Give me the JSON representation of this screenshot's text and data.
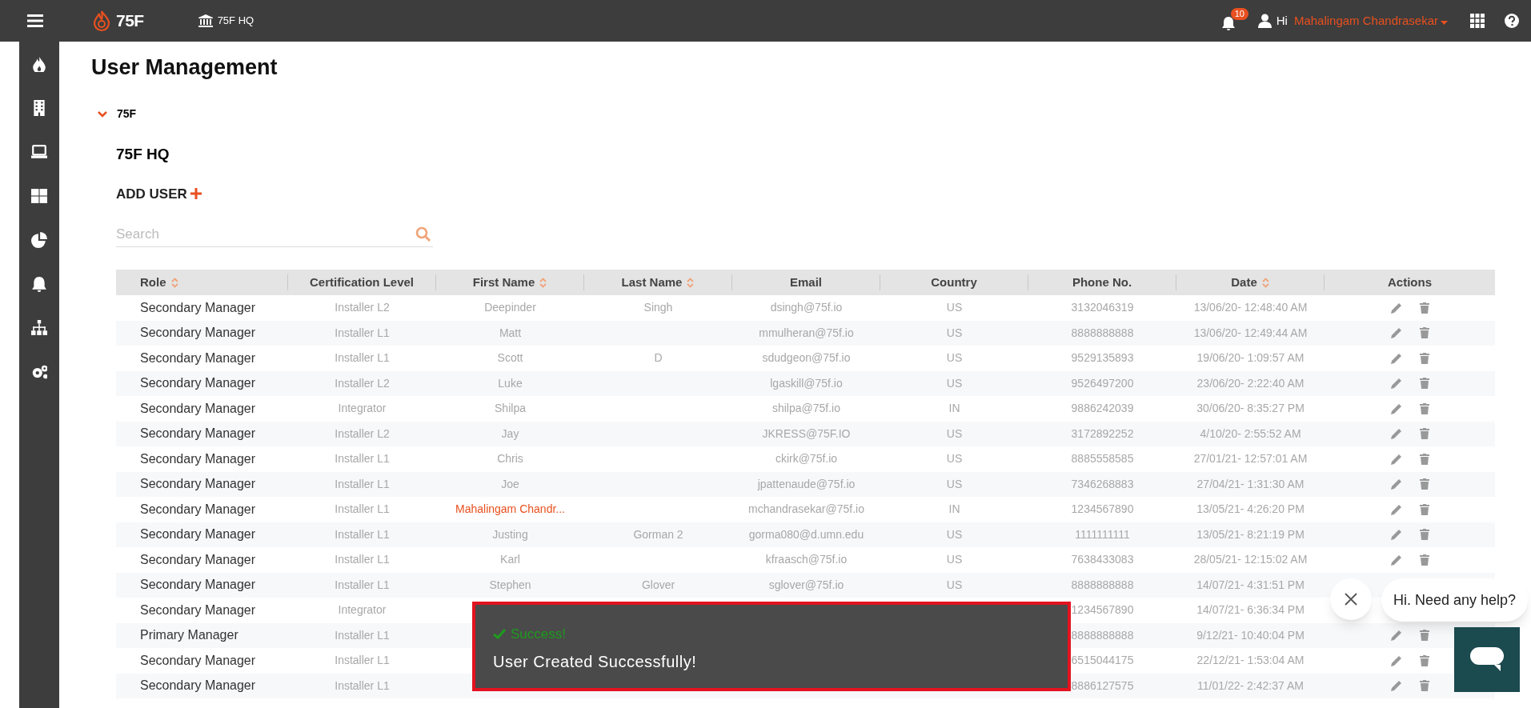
{
  "topbar": {
    "logo": "75F",
    "site": "75F HQ",
    "notifications": "10",
    "greeting": "Hi",
    "user": "Mahalingam Chandrasekar"
  },
  "page_title": "User Management",
  "tree": {
    "label": "75F",
    "expanded": true,
    "site": "75F HQ"
  },
  "add_user": "ADD USER",
  "search": {
    "placeholder": "Search"
  },
  "table": {
    "columns": [
      {
        "label": "Role",
        "sortable": true
      },
      {
        "label": "Certification Level",
        "sortable": false
      },
      {
        "label": "First Name",
        "sortable": true
      },
      {
        "label": "Last Name",
        "sortable": true
      },
      {
        "label": "Email",
        "sortable": false
      },
      {
        "label": "Country",
        "sortable": false
      },
      {
        "label": "Phone No.",
        "sortable": false
      },
      {
        "label": "Date",
        "sortable": true
      },
      {
        "label": "Actions",
        "sortable": false
      }
    ],
    "rows": [
      {
        "role": "Secondary Manager",
        "certification": "Installer L2",
        "first_name": "Deepinder",
        "last_name": "Singh",
        "email": "dsingh@75f.io",
        "country": "US",
        "phone": "3132046319",
        "date": "13/06/20- 12:48:40 AM"
      },
      {
        "role": "Secondary Manager",
        "certification": "Installer L1",
        "first_name": "Matt",
        "email": "mmulheran@75f.io",
        "country": "US",
        "phone": "8888888888",
        "date": "13/06/20- 12:49:44 AM"
      },
      {
        "role": "Secondary Manager",
        "certification": "Installer L1",
        "first_name": "Scott",
        "last_name": "D",
        "email": "sdudgeon@75f.io",
        "country": "US",
        "phone": "9529135893",
        "date": "19/06/20- 1:09:57 AM"
      },
      {
        "role": "Secondary Manager",
        "certification": "Installer L2",
        "first_name": "Luke",
        "email": "lgaskill@75f.io",
        "country": "US",
        "phone": "9526497200",
        "date": "23/06/20- 2:22:40 AM"
      },
      {
        "role": "Secondary Manager",
        "certification": "Integrator",
        "first_name": "Shilpa",
        "email": "shilpa@75f.io",
        "country": "IN",
        "phone": "9886242039",
        "date": "30/06/20- 8:35:27 PM"
      },
      {
        "role": "Secondary Manager",
        "certification": "Installer L2",
        "first_name": "Jay",
        "email": "JKRESS@75F.IO",
        "country": "US",
        "phone": "3172892252",
        "date": "4/10/20- 2:55:52 AM"
      },
      {
        "role": "Secondary Manager",
        "certification": "Installer L1",
        "first_name": "Chris",
        "email": "ckirk@75f.io",
        "country": "US",
        "phone": "8885558585",
        "date": "27/01/21- 12:57:01 AM"
      },
      {
        "role": "Secondary Manager",
        "certification": "Installer L1",
        "first_name": "Joe",
        "email": "jpattenaude@75f.io",
        "country": "US",
        "phone": "7346268883",
        "date": "27/04/21- 1:31:30 AM"
      },
      {
        "role": "Secondary Manager",
        "certification": "Installer L1",
        "first_name": "Mahalingam Chandr...",
        "email": "mchandrasekar@75f.io",
        "country": "IN",
        "phone": "1234567890",
        "date": "13/05/21- 4:26:20 PM",
        "current_user": true
      },
      {
        "role": "Secondary Manager",
        "certification": "Installer L1",
        "first_name": "Justing",
        "last_name": "Gorman 2",
        "email": "gorma080@d.umn.edu",
        "country": "US",
        "phone": "1111111111",
        "date": "13/05/21- 8:21:19 PM"
      },
      {
        "role": "Secondary Manager",
        "certification": "Installer L1",
        "first_name": "Karl",
        "email": "kfraasch@75f.io",
        "country": "US",
        "phone": "7638433083",
        "date": "28/05/21- 12:15:02 AM"
      },
      {
        "role": "Secondary Manager",
        "certification": "Installer L1",
        "first_name": "Stephen",
        "last_name": "Glover",
        "email": "sglover@75f.io",
        "country": "US",
        "phone": "8888888888",
        "date": "14/07/21- 4:31:51 PM"
      },
      {
        "role": "Secondary Manager",
        "certification": "Integrator",
        "phone": "1234567890",
        "date": "14/07/21- 6:36:34 PM"
      },
      {
        "role": "Primary Manager",
        "certification": "Installer L1",
        "phone": "8888888888",
        "date": "9/12/21- 10:40:04 PM"
      },
      {
        "role": "Secondary Manager",
        "certification": "Installer L1",
        "phone": "6515044175",
        "date": "22/12/21- 1:53:04 AM"
      },
      {
        "role": "Secondary Manager",
        "certification": "Installer L1",
        "phone": "8886127575",
        "date": "11/01/22- 2:42:37 AM"
      }
    ]
  },
  "toast": {
    "title": "Success!",
    "message": "User Created Successfully!"
  },
  "chat": {
    "greeting": "Hi. Need any help?"
  }
}
